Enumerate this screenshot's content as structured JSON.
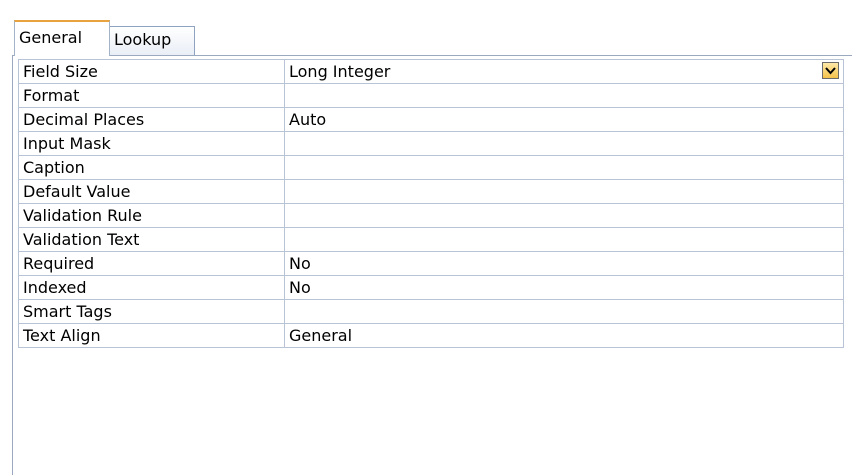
{
  "tabs": [
    {
      "label": "General",
      "active": true
    },
    {
      "label": "Lookup",
      "active": false
    }
  ],
  "properties": [
    {
      "label": "Field Size",
      "value": "Long Integer"
    },
    {
      "label": "Format",
      "value": ""
    },
    {
      "label": "Decimal Places",
      "value": "Auto"
    },
    {
      "label": "Input Mask",
      "value": ""
    },
    {
      "label": "Caption",
      "value": ""
    },
    {
      "label": "Default Value",
      "value": ""
    },
    {
      "label": "Validation Rule",
      "value": ""
    },
    {
      "label": "Validation Text",
      "value": ""
    },
    {
      "label": "Required",
      "value": "No"
    },
    {
      "label": "Indexed",
      "value": "No"
    },
    {
      "label": "Smart Tags",
      "value": ""
    },
    {
      "label": "Text Align",
      "value": "General"
    }
  ],
  "dropdown_icon": "chevron-down-icon",
  "colors": {
    "active_tab_accent": "#e8a33e",
    "grid_line": "#b8c4d6",
    "dropdown_fill": "#f4c24a"
  }
}
